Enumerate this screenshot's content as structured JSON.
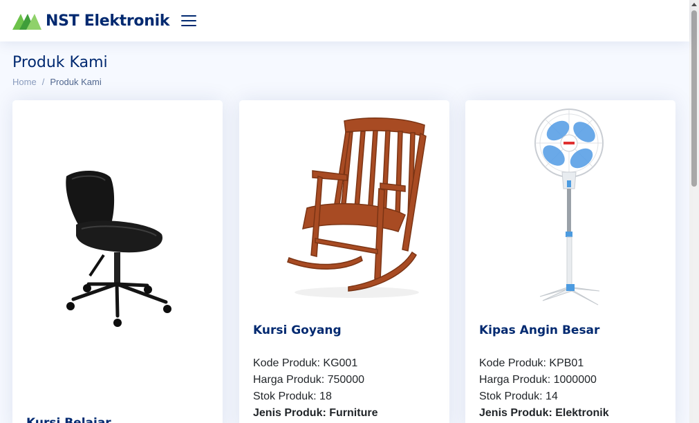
{
  "header": {
    "brand": "NST Elektronik",
    "logo_icon": "nst-triangle-logo",
    "menu_icon": "hamburger-list-icon"
  },
  "page": {
    "title": "Produk Kami",
    "breadcrumb": [
      {
        "label": "Home"
      },
      {
        "label": "Produk Kami"
      }
    ]
  },
  "products": [
    {
      "name": "Kursi Belajar",
      "image": "black-office-chair"
    },
    {
      "name": "Kursi Goyang",
      "image": "wooden-rocking-chair",
      "kode": "Kode Produk: KG001",
      "harga": "Harga Produk: 750000",
      "stok": "Stok Produk: 18",
      "jenis": "Jenis Produk: Furniture"
    },
    {
      "name": "Kipas Angin Besar",
      "image": "standing-electric-fan",
      "kode": "Kode Produk: KPB01",
      "harga": "Harga Produk: 1000000",
      "stok": "Stok Produk: 14",
      "jenis": "Jenis Produk: Elektronik"
    }
  ],
  "colors": {
    "brand": "#012970",
    "background": "#f6f9ff",
    "logo_green": "#6cc24a",
    "breadcrumb_muted": "#899bbd"
  }
}
